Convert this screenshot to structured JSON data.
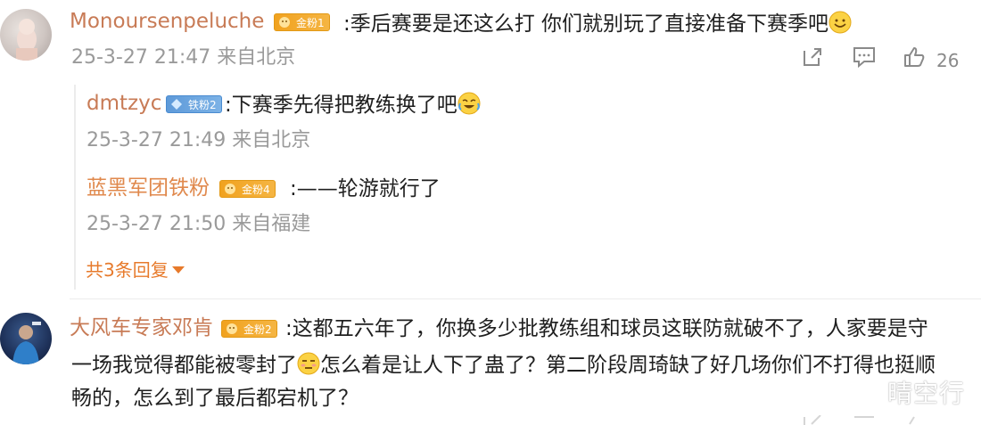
{
  "comments": [
    {
      "username": "Monoursenpeluche",
      "badge": "金粉1",
      "text": ":季后赛要是还这么打 你们就别玩了直接准备下赛季吧",
      "meta": "25-3-27 21:47 来自北京",
      "likes": "26",
      "replies": [
        {
          "username": "dmtzyc",
          "badge": "铁粉2",
          "text": ":下赛季先得把教练换了吧",
          "meta": "25-3-27 21:49 来自北京"
        },
        {
          "username": "蓝黑军团铁粉",
          "badge": "金粉4",
          "text": ":——轮游就行了",
          "meta": "25-3-27 21:50 来自福建"
        }
      ],
      "more_replies": "共3条回复"
    },
    {
      "username": "大风车专家邓肯",
      "badge": "金粉2",
      "text_lines": [
        ":这都五六年了，你换多少批教练组和球员这联防就破不了，人家要是守",
        "一场我觉得都能被零封了",
        "怎么着是让人下了蛊了？第二阶段周琦缺了好几场你们不打得也挺顺",
        "畅的，怎么到了最后都宕机了？"
      ]
    }
  ],
  "watermark": "晴空行",
  "colors": {
    "username": "#c87b56",
    "accent": "#e77a2b",
    "meta": "#9a9a9a",
    "gold_badge": "#f1a21f",
    "iron_badge": "#5e9ad9"
  },
  "icons": [
    "share-icon",
    "comment-icon",
    "like-icon",
    "smile-emoji",
    "laugh-cry-emoji",
    "embarrassed-emoji"
  ]
}
